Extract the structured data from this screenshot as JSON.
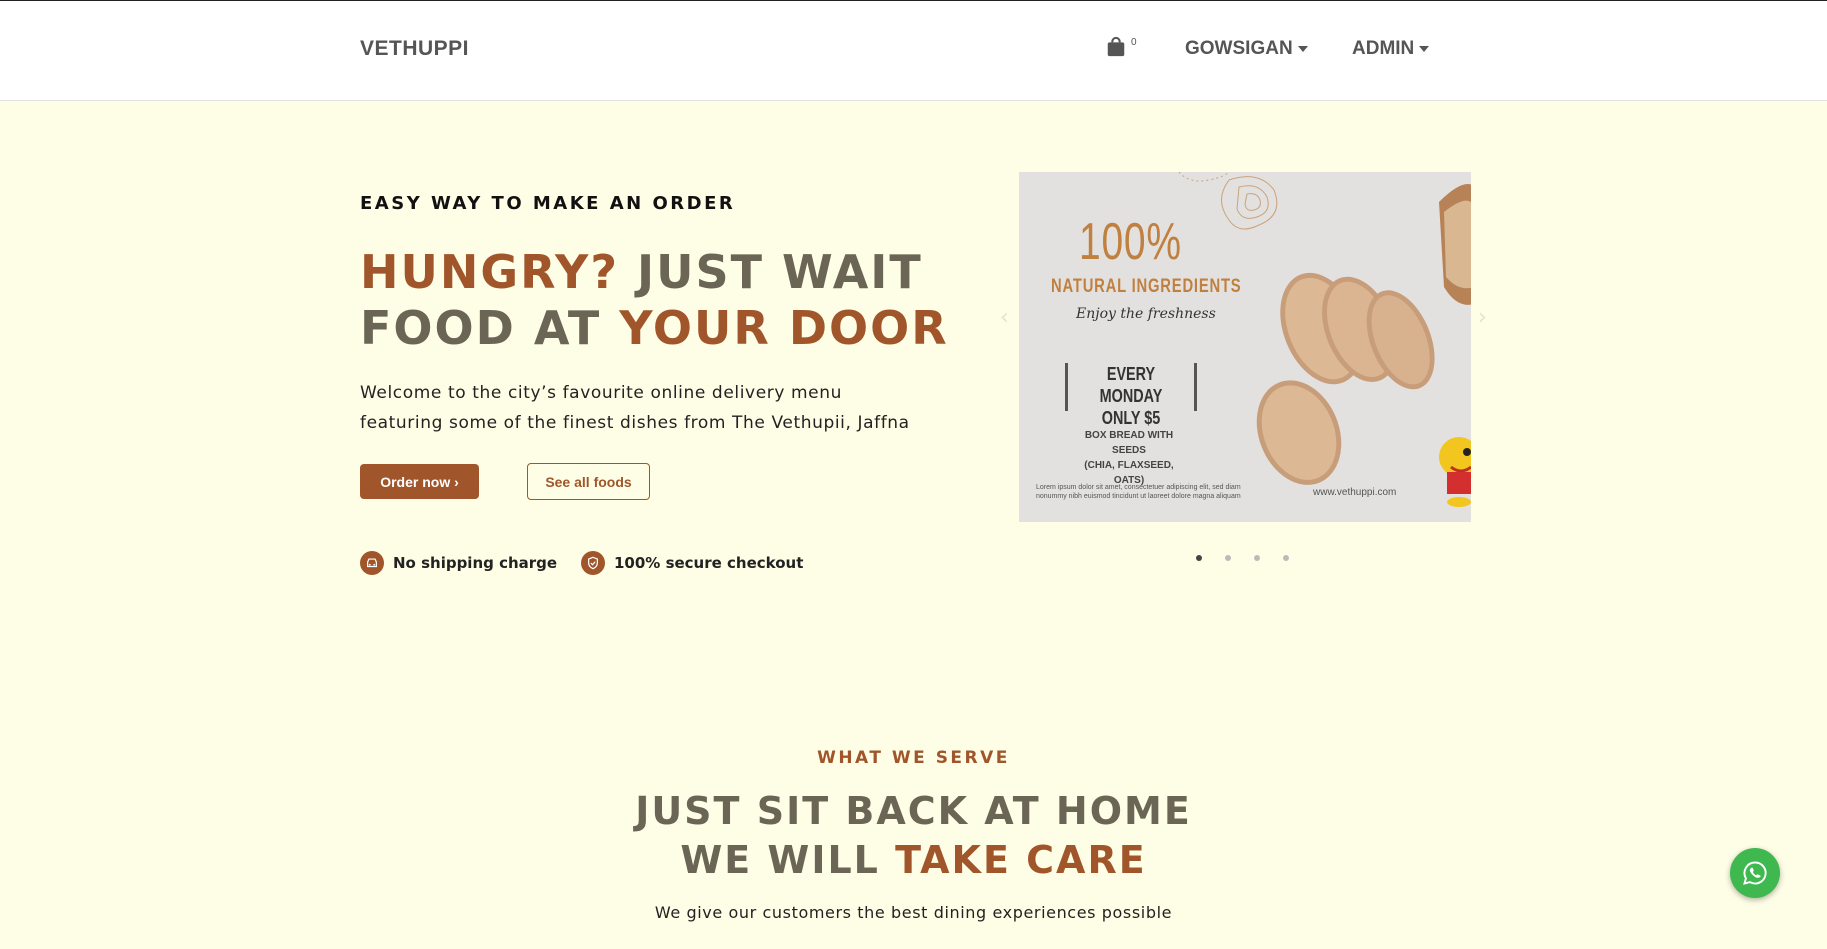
{
  "navbar": {
    "brand": "VETHUPPI",
    "cart_count": "0",
    "user_menu": "GOWSIGAN",
    "admin_menu": "ADMIN"
  },
  "hero": {
    "eyebrow": "EASY WAY TO MAKE AN ORDER",
    "title_line1_accent": "HUNGRY?",
    "title_line1_rest": " JUST WAIT",
    "title_line2_rest": "FOOD AT ",
    "title_line2_accent": "YOUR DOOR",
    "description_line1": "Welcome to the city’s favourite online delivery menu",
    "description_line2": "featuring some of the finest dishes from The Vethupii, Jaffna",
    "order_button": "Order now ›",
    "all_foods_button": "See all foods",
    "features": [
      {
        "icon": "car-icon",
        "label": "No shipping charge"
      },
      {
        "icon": "shield-icon",
        "label": "100% secure checkout"
      }
    ]
  },
  "carousel": {
    "slide_count": 4,
    "active_slide": 1,
    "slide": {
      "headline": "100%",
      "subheadline": "NATURAL INGREDIENTS",
      "script": "Enjoy the freshness",
      "offer_line1": "EVERY MONDAY",
      "offer_line2": "ONLY $5",
      "product_line1": "BOX BREAD WITH SEEDS",
      "product_line2": "(CHIA, FLAXSEED, OATS)",
      "lorem": "Lorem ipsum dolor sit amet, consectetuer adipiscing elit, sed diam nonummy nibh euismod tincidunt ut laoreet dolore magna aliquam",
      "url": "www.vethuppi.com"
    }
  },
  "serve": {
    "eyebrow": "WHAT WE SERVE",
    "title_line1": "JUST SIT BACK AT HOME",
    "title_line2_rest": "WE WILL ",
    "title_line2_accent": "TAKE CARE",
    "description": "We give our customers the best dining experiences possible"
  },
  "colors": {
    "accent": "#a0562a",
    "heading": "#6b6555",
    "background": "#fefde6",
    "whatsapp": "#3fb84f"
  }
}
